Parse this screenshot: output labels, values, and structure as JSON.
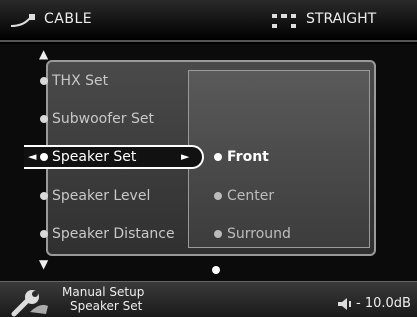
{
  "header": {
    "source_label": "CABLE",
    "source_icon": "cable-icon",
    "mode_label": "STRAIGHT",
    "mode_icon": "speaker-layout-icon"
  },
  "menu": {
    "items": [
      {
        "label": "THX Set"
      },
      {
        "label": "Subwoofer Set"
      },
      {
        "label": "Speaker Set",
        "selected": true
      },
      {
        "label": "Speaker Level"
      },
      {
        "label": "Speaker Distance"
      }
    ],
    "submenu": [
      {
        "label": "Front",
        "active": true
      },
      {
        "label": "Center"
      },
      {
        "label": "Surround"
      }
    ]
  },
  "footer": {
    "line1": "Manual Setup",
    "line2": "Speaker Set",
    "volume": "- 10.0dB",
    "setup_icon": "wrench-icon",
    "volume_icon": "speaker-volume-icon"
  },
  "colors": {
    "background": "#000000",
    "panel": "#3a3a3a",
    "panel_border": "#9a9a9a",
    "text": "#ffffff",
    "text_dim": "#c8c8c8"
  }
}
